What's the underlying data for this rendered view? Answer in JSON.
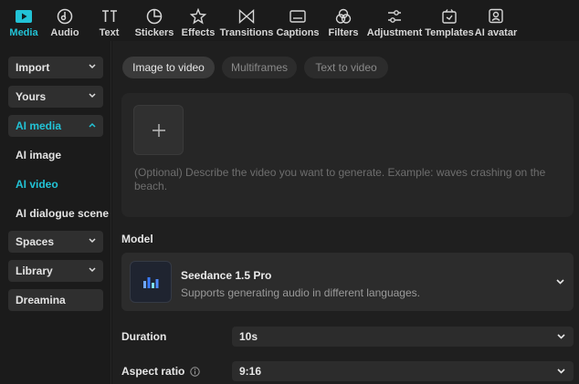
{
  "toolbar": {
    "tools": [
      {
        "label": "Media",
        "icon": "media-icon"
      },
      {
        "label": "Audio",
        "icon": "audio-icon"
      },
      {
        "label": "Text",
        "icon": "text-icon"
      },
      {
        "label": "Stickers",
        "icon": "stickers-icon"
      },
      {
        "label": "Effects",
        "icon": "effects-icon"
      },
      {
        "label": "Transitions",
        "icon": "transitions-icon"
      },
      {
        "label": "Captions",
        "icon": "captions-icon"
      },
      {
        "label": "Filters",
        "icon": "filters-icon"
      },
      {
        "label": "Adjustment",
        "icon": "adjustment-icon"
      },
      {
        "label": "Templates",
        "icon": "templates-icon"
      },
      {
        "label": "AI avatar",
        "icon": "ai-avatar-icon"
      }
    ],
    "active": "Media",
    "accent_color": "#22c3d6"
  },
  "sidebar": {
    "items": [
      {
        "label": "Import"
      },
      {
        "label": "Yours"
      },
      {
        "label": "AI media"
      },
      {
        "label": "Spaces"
      },
      {
        "label": "Library"
      },
      {
        "label": "Dreamina"
      }
    ],
    "ai_media_subitems": [
      {
        "label": "AI image"
      },
      {
        "label": "AI video"
      },
      {
        "label": "AI dialogue scene"
      }
    ],
    "active_subitem": "AI video"
  },
  "main": {
    "mode_tabs": [
      {
        "label": "Image to video"
      },
      {
        "label": "Multiframes"
      },
      {
        "label": "Text to video"
      }
    ],
    "active_tab": "Image to video",
    "prompt_placeholder": "(Optional) Describe the video you want to generate. Example: waves crashing on the beach.",
    "model_label": "Model",
    "model": {
      "name": "Seedance 1.5 Pro",
      "description": "Supports generating audio in different languages."
    },
    "duration_label": "Duration",
    "duration_value": "10s",
    "aspect_label": "Aspect ratio",
    "aspect_value": "9:16"
  }
}
